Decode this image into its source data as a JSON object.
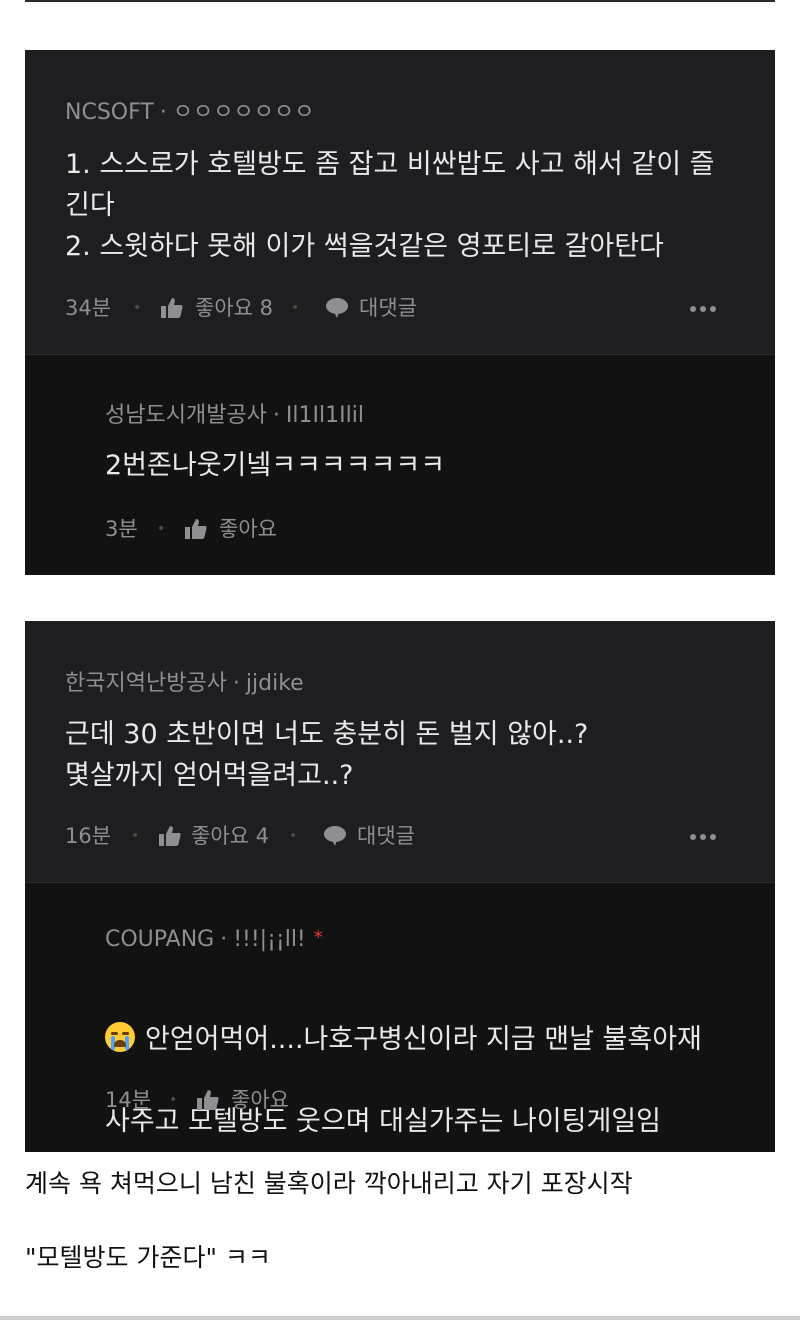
{
  "cards": [
    {
      "comment": {
        "company": "NCSOFT",
        "separator": "·",
        "username": "ㅇㅇㅇㅇㅇㅇㅇ",
        "text": "1. 스스로가 호텔방도 좀 잡고 비싼밥도 사고 해서 같이 즐\n긴다\n2. 스윗하다 못해 이가 썩을것같은 영포티로 갈아탄다",
        "time": "34분",
        "like_label": "좋아요 8",
        "reply_label": "대댓글"
      },
      "reply": {
        "company": "성남도시개발공사",
        "separator": "·",
        "username": "Il1Il1Ilil",
        "text": "2번존나웃기넼ㅋㅋㅋㅋㅋㅋㅋ",
        "time": "3분",
        "like_label": "좋아요"
      }
    },
    {
      "comment": {
        "company": "한국지역난방공사",
        "separator": "·",
        "username": "jjdike",
        "text": "근데 30 초반이면 너도 충분히 돈 벌지 않아..?\n몇살까지 얻어먹을려고..?",
        "time": "16분",
        "like_label": "좋아요 4",
        "reply_label": "대댓글"
      },
      "reply": {
        "company": "COUPANG",
        "separator": "·",
        "username": "!!!|¡¡ll!",
        "author_marker": "*",
        "emoji": "loudly-crying-face",
        "text_line1": "안얻어먹어....나호구병신이라 지금 맨날 불혹아재",
        "text_line2": "사주고 모텔방도 웃으며 대실가주는 나이팅게일임",
        "time": "14분",
        "like_label": "좋아요"
      }
    }
  ],
  "captions": {
    "line1": "계속 욕 쳐먹으니 남친 불혹이라 깍아내리고 자기 포장시작",
    "line2": "\"모텔방도 가준다\" ㅋㅋ"
  },
  "colors": {
    "card_bg": "#1e1e20",
    "reply_bg": "#121213",
    "text_primary": "#e9e9ec",
    "text_secondary": "#8e8e93",
    "author_marker": "#e53935"
  }
}
